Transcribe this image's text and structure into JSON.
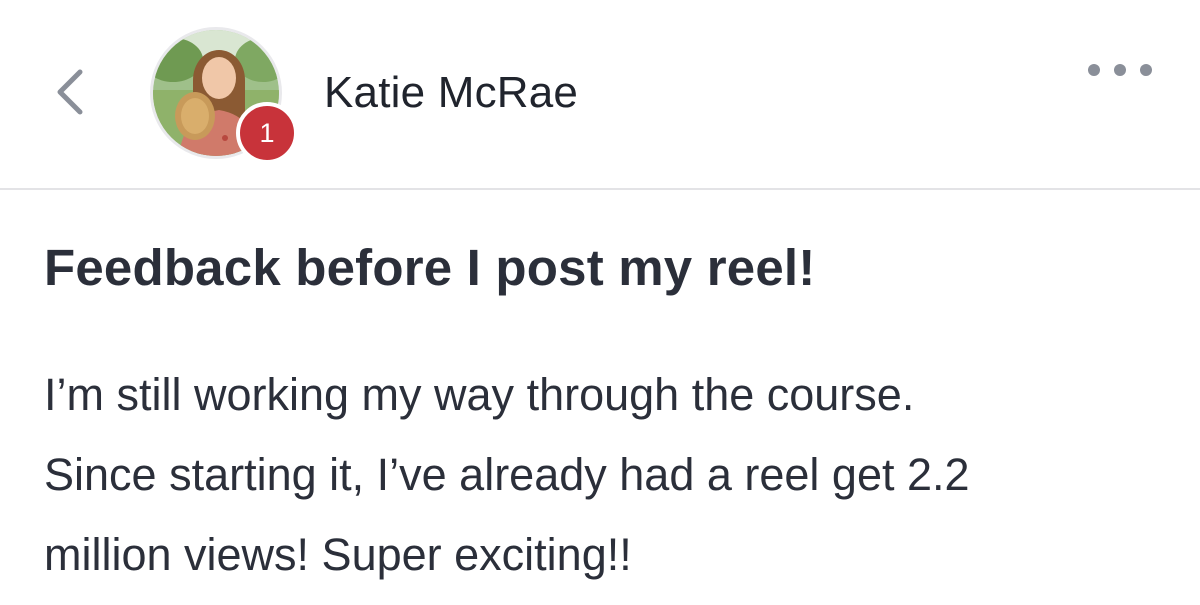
{
  "header": {
    "author_name": "Katie McRae",
    "avatar_badge": "1",
    "back_icon": "chevron-left-icon",
    "more_icon": "more-horizontal-icon"
  },
  "post": {
    "title": "Feedback before I post my reel!",
    "body_lines": [
      "I’m still working my way through the course.",
      "Since starting it, I’ve already had a reel get 2.2",
      "million views! Super exciting!!"
    ]
  },
  "colors": {
    "badge": "#c8333a",
    "text": "#2b2f3a",
    "divider": "#e3e3e6",
    "icon": "#8a8f99"
  }
}
